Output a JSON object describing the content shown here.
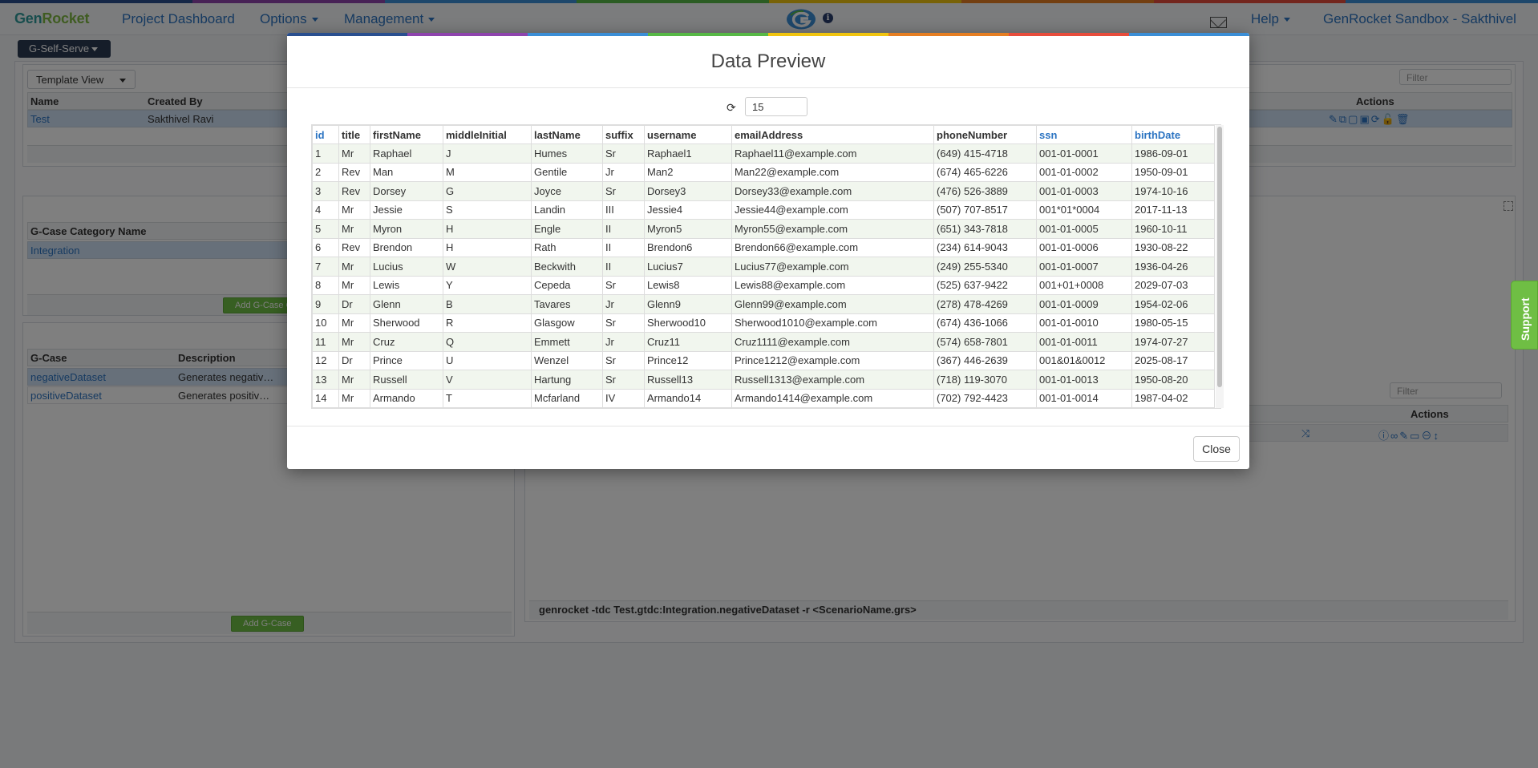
{
  "app": {
    "brand_part1": "Gen",
    "brand_part2": "Rocket",
    "top_colors": [
      "#2a4f8f",
      "#8e44ad",
      "#3b8ed6",
      "#57b846",
      "#f1c40f",
      "#e67e22",
      "#e74c3c",
      "#3b8ed6"
    ]
  },
  "nav": {
    "project_dashboard": "Project Dashboard",
    "options": "Options",
    "management": "Management",
    "help": "Help",
    "account": "GenRocket Sandbox - Sakthivel"
  },
  "background": {
    "self_serve": "G-Self-Serve",
    "template_view": "Template View",
    "filter_placeholder": "Filter",
    "templates_table": {
      "headers": [
        "Name",
        "Created By"
      ],
      "actions_header": "Actions",
      "row": [
        "Test",
        "Sakthivel Ravi"
      ]
    },
    "category_table": {
      "header": "G-Case Category Name",
      "row": "Integration",
      "add_button": "Add G-Case Ca"
    },
    "gcase_table": {
      "headers": [
        "G-Case",
        "Description"
      ],
      "rows": [
        [
          "negativeDataset",
          "Generates negativ…"
        ],
        [
          "positiveDataset",
          "Generates positiv…"
        ]
      ],
      "add_button": "Add G-Case"
    },
    "right_panel": {
      "filter_placeholder": "Filter",
      "actions_header": "Actions",
      "command": "genrocket -tdc Test.gtdc:Integration.negativeDataset -r <ScenarioName.grs>"
    },
    "support": "Support"
  },
  "modal": {
    "title": "Data Preview",
    "rows_value": "15",
    "close_label": "Close",
    "columns": [
      "id",
      "title",
      "firstName",
      "middleInitial",
      "lastName",
      "suffix",
      "username",
      "emailAddress",
      "phoneNumber",
      "ssn",
      "birthDate"
    ],
    "blue_columns": [
      "id",
      "ssn",
      "birthDate"
    ],
    "rows": [
      [
        "1",
        "Mr",
        "Raphael",
        "J",
        "Humes",
        "Sr",
        "Raphael1",
        "Raphael11@example.com",
        "(649) 415-4718",
        "001-01-0001",
        "1986-09-01"
      ],
      [
        "2",
        "Rev",
        "Man",
        "M",
        "Gentile",
        "Jr",
        "Man2",
        "Man22@example.com",
        "(674) 465-6226",
        "001-01-0002",
        "1950-09-01"
      ],
      [
        "3",
        "Rev",
        "Dorsey",
        "G",
        "Joyce",
        "Sr",
        "Dorsey3",
        "Dorsey33@example.com",
        "(476) 526-3889",
        "001-01-0003",
        "1974-10-16"
      ],
      [
        "4",
        "Mr",
        "Jessie",
        "S",
        "Landin",
        "III",
        "Jessie4",
        "Jessie44@example.com",
        "(507) 707-8517",
        "001*01*0004",
        "2017-11-13"
      ],
      [
        "5",
        "Mr",
        "Myron",
        "H",
        "Engle",
        "II",
        "Myron5",
        "Myron55@example.com",
        "(651) 343-7818",
        "001-01-0005",
        "1960-10-11"
      ],
      [
        "6",
        "Rev",
        "Brendon",
        "H",
        "Rath",
        "II",
        "Brendon6",
        "Brendon66@example.com",
        "(234) 614-9043",
        "001-01-0006",
        "1930-08-22"
      ],
      [
        "7",
        "Mr",
        "Lucius",
        "W",
        "Beckwith",
        "II",
        "Lucius7",
        "Lucius77@example.com",
        "(249) 255-5340",
        "001-01-0007",
        "1936-04-26"
      ],
      [
        "8",
        "Mr",
        "Lewis",
        "Y",
        "Cepeda",
        "Sr",
        "Lewis8",
        "Lewis88@example.com",
        "(525) 637-9422",
        "001+01+0008",
        "2029-07-03"
      ],
      [
        "9",
        "Dr",
        "Glenn",
        "B",
        "Tavares",
        "Jr",
        "Glenn9",
        "Glenn99@example.com",
        "(278) 478-4269",
        "001-01-0009",
        "1954-02-06"
      ],
      [
        "10",
        "Mr",
        "Sherwood",
        "R",
        "Glasgow",
        "Sr",
        "Sherwood10",
        "Sherwood1010@example.com",
        "(674) 436-1066",
        "001-01-0010",
        "1980-05-15"
      ],
      [
        "11",
        "Mr",
        "Cruz",
        "Q",
        "Emmett",
        "Jr",
        "Cruz11",
        "Cruz1111@example.com",
        "(574) 658-7801",
        "001-01-0011",
        "1974-07-27"
      ],
      [
        "12",
        "Dr",
        "Prince",
        "U",
        "Wenzel",
        "Sr",
        "Prince12",
        "Prince1212@example.com",
        "(367) 446-2639",
        "001&01&0012",
        "2025-08-17"
      ],
      [
        "13",
        "Mr",
        "Russell",
        "V",
        "Hartung",
        "Sr",
        "Russell13",
        "Russell1313@example.com",
        "(718) 119-3070",
        "001-01-0013",
        "1950-08-20"
      ],
      [
        "14",
        "Mr",
        "Armando",
        "T",
        "Mcfarland",
        "IV",
        "Armando14",
        "Armando1414@example.com",
        "(702) 792-4423",
        "001-01-0014",
        "1987-04-02"
      ]
    ]
  }
}
